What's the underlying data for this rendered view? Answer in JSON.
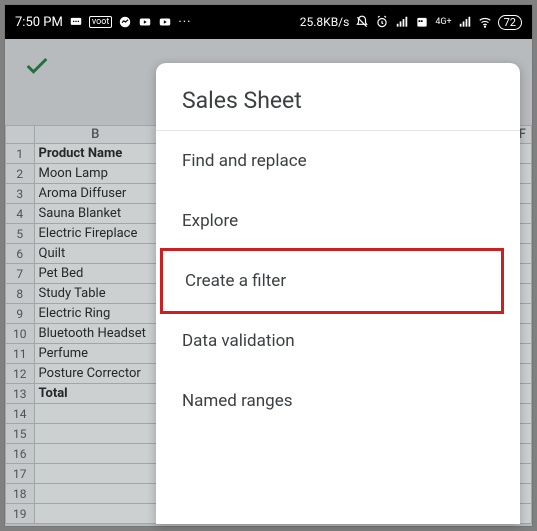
{
  "status": {
    "time": "7:50 PM",
    "net_speed": "25.8KB/s",
    "battery": "72",
    "small_label": "voot",
    "signal_label": "4G+"
  },
  "toolbar": {
    "confirm_icon": "check"
  },
  "sheet": {
    "columns": [
      "",
      "B",
      "",
      "F"
    ],
    "header_row": [
      "Product Name"
    ],
    "rows": [
      {
        "n": "1",
        "name": "Product Name",
        "bold": true
      },
      {
        "n": "2",
        "name": "Moon Lamp"
      },
      {
        "n": "3",
        "name": "Aroma Diffuser"
      },
      {
        "n": "4",
        "name": "Sauna Blanket"
      },
      {
        "n": "5",
        "name": "Electric Fireplace"
      },
      {
        "n": "6",
        "name": "Quilt"
      },
      {
        "n": "7",
        "name": "Pet Bed"
      },
      {
        "n": "8",
        "name": "Study Table"
      },
      {
        "n": "9",
        "name": "Electric Ring"
      },
      {
        "n": "10",
        "name": "Bluetooth Headset"
      },
      {
        "n": "11",
        "name": "Perfume"
      },
      {
        "n": "12",
        "name": "Posture Corrector"
      },
      {
        "n": "13",
        "name": "Total",
        "bold": true
      },
      {
        "n": "14",
        "name": ""
      },
      {
        "n": "15",
        "name": ""
      },
      {
        "n": "16",
        "name": ""
      },
      {
        "n": "17",
        "name": ""
      },
      {
        "n": "18",
        "name": ""
      },
      {
        "n": "19",
        "name": ""
      }
    ]
  },
  "popup": {
    "title": "Sales Sheet",
    "items": [
      {
        "label": "Find and replace",
        "highlight": false
      },
      {
        "label": "Explore",
        "highlight": false
      },
      {
        "label": "Create a filter",
        "highlight": true
      },
      {
        "label": "Data validation",
        "highlight": false
      },
      {
        "label": "Named ranges",
        "highlight": false
      }
    ]
  }
}
